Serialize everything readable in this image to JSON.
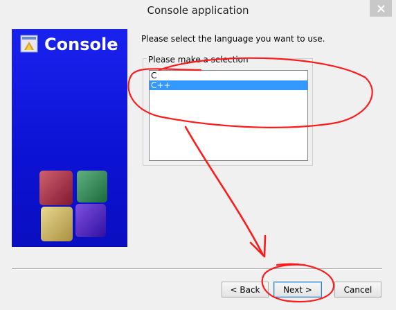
{
  "window": {
    "title": "Console application"
  },
  "banner": {
    "title": "Console"
  },
  "wizard": {
    "prompt": "Please select the language you want to use.",
    "group_label": "Please make a selection",
    "languages": [
      {
        "label": "C",
        "selected": false
      },
      {
        "label": "C++",
        "selected": true
      }
    ]
  },
  "buttons": {
    "back": "< Back",
    "next": "Next >",
    "cancel": "Cancel"
  },
  "colors": {
    "banner_blue": "#0c12d2",
    "selection": "#3399ff",
    "annotation": "#ff1a1a"
  },
  "icons": [
    "close-icon",
    "app-logo-icon",
    "color-cubes-graphic"
  ]
}
